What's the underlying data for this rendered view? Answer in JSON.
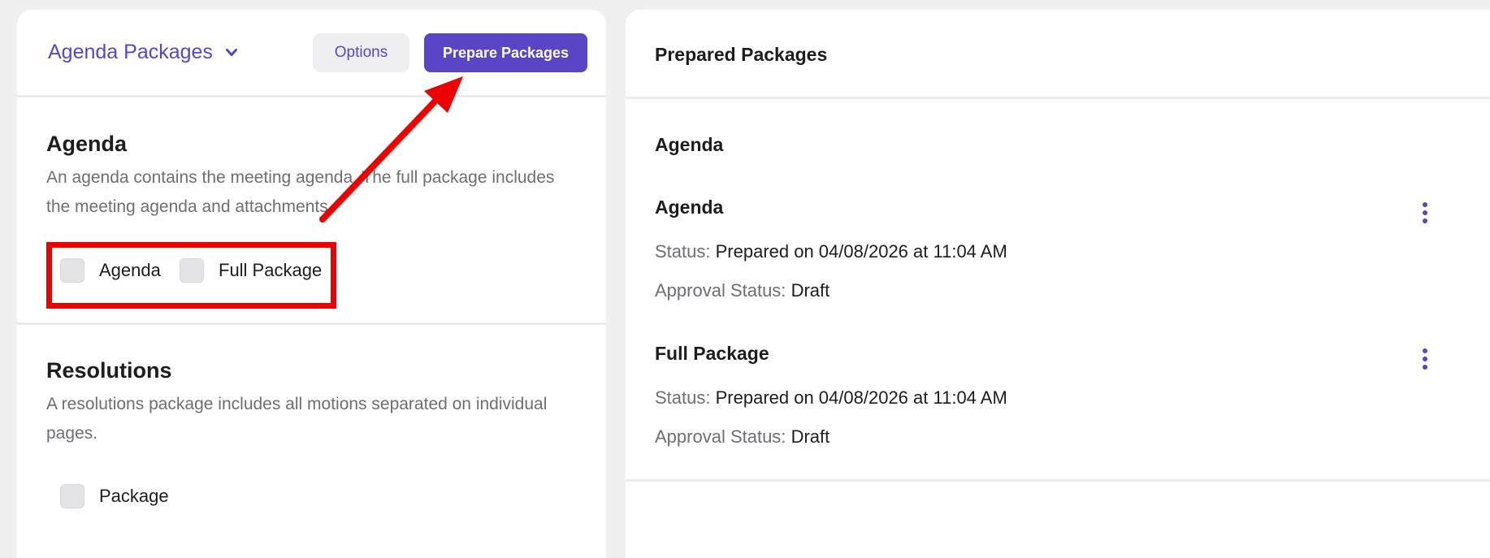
{
  "left_panel": {
    "package_selector": {
      "label": "Agenda Packages",
      "icon": "chevron-down-icon"
    },
    "options_label": "Options",
    "prepare_label": "Prepare Packages",
    "sections": [
      {
        "title": "Agenda",
        "description": "An agenda contains the meeting agenda. The full package includes the meeting agenda and attachments.",
        "options": [
          "Agenda",
          "Full Package"
        ]
      },
      {
        "title": "Resolutions",
        "description": "A resolutions package includes all motions separated on individual pages.",
        "options": [
          "Package"
        ]
      }
    ]
  },
  "right_panel": {
    "title": "Prepared Packages",
    "group_title": "Agenda",
    "packages": [
      {
        "name": "Agenda",
        "status_label": "Status:",
        "status_value": "Prepared on 04/08/2026 at 11:04 AM",
        "approval_label": "Approval Status:",
        "approval_value": "Draft"
      },
      {
        "name": "Full Package",
        "status_label": "Status:",
        "status_value": "Prepared on 04/08/2026 at 11:04 AM",
        "approval_label": "Approval Status:",
        "approval_value": "Draft"
      }
    ]
  },
  "colors": {
    "accent": "#5a45c6",
    "annotation": "#ee0000",
    "background": "#f0f0f0"
  }
}
